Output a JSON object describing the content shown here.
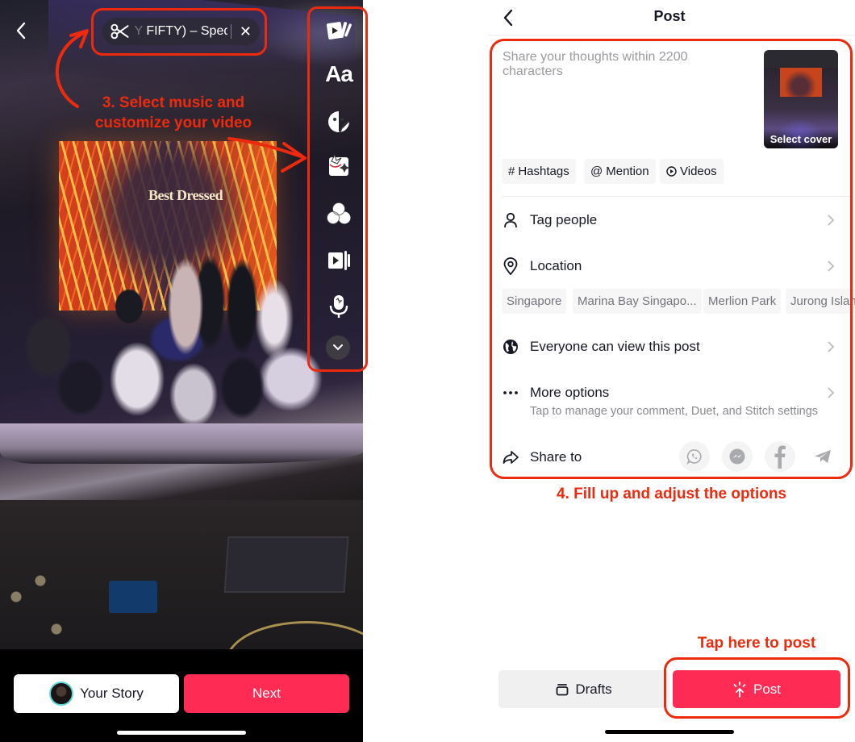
{
  "editor": {
    "music_track_faded": "Y",
    "music_track": " FIFTY) – Sped",
    "tools": [
      {
        "name": "templates",
        "label": ""
      },
      {
        "name": "text",
        "label": "Aa"
      },
      {
        "name": "stickers",
        "label": ""
      },
      {
        "name": "effects",
        "label": ""
      },
      {
        "name": "filters",
        "label": ""
      },
      {
        "name": "clips",
        "label": ""
      },
      {
        "name": "voice",
        "label": ""
      }
    ],
    "video_overlay_text": "Best Dressed",
    "your_story_label": "Your Story",
    "next_label": "Next"
  },
  "post": {
    "title": "Post",
    "caption_placeholder": "Share your thoughts within 2200 characters",
    "cover_label": "Select cover",
    "chips": [
      {
        "icon": "#",
        "label": "Hashtags"
      },
      {
        "icon": "@",
        "label": "Mention"
      },
      {
        "icon": "play",
        "label": "Videos"
      }
    ],
    "rows": {
      "tag_people": "Tag people",
      "location": "Location",
      "privacy": "Everyone can view this post",
      "more_options": "More options",
      "more_options_sub": "Tap to manage your comment, Duet, and Stitch settings",
      "share_to": "Share to"
    },
    "location_suggestions": [
      "Singapore",
      "Marina Bay Singapo...",
      "Merlion Park",
      "Jurong Islan"
    ],
    "share_targets": [
      "WhatsApp",
      "Messenger",
      "Facebook",
      "Telegram"
    ],
    "drafts_label": "Drafts",
    "post_label": "Post"
  },
  "annotations": {
    "step3": "3. Select music and customize your video",
    "step3_line1": "3. Select music and",
    "step3_line2": "customize your video",
    "step4": "4. Fill up and adjust the options",
    "tap_post": "Tap here to post"
  },
  "colors": {
    "accent": "#fe2c55",
    "annotation": "#ee2a0e",
    "text_primary": "#161823",
    "text_secondary": "#8a8b91"
  }
}
